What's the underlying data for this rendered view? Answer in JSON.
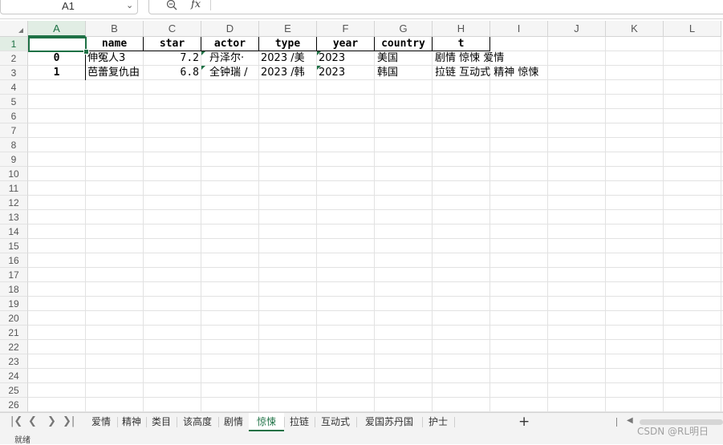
{
  "formula_bar": {
    "name_box": "A1",
    "fx_label": "fx",
    "formula": ""
  },
  "columns": [
    "A",
    "B",
    "C",
    "D",
    "E",
    "F",
    "G",
    "H",
    "I",
    "J",
    "K",
    "L"
  ],
  "rows": [
    "1",
    "2",
    "3",
    "4",
    "5",
    "6",
    "7",
    "8",
    "9",
    "10",
    "11",
    "12",
    "13",
    "14",
    "15",
    "16",
    "17",
    "18",
    "19",
    "20",
    "21",
    "22",
    "23",
    "24",
    "25",
    "26"
  ],
  "active_cell": "A1",
  "table": {
    "headers": [
      "name",
      "star",
      "actor",
      "type",
      "year",
      "country",
      "t"
    ],
    "records": [
      {
        "index": "0",
        "name": "伸冤人3",
        "star": "7.2",
        "actor": "丹泽尔·",
        "type": "2023  /美",
        "year": "2023",
        "country": "美国",
        "t": "剧情  惊悚  爱情"
      },
      {
        "index": "1",
        "name": "芭蕾复仇由",
        "star": "6.8",
        "actor": "全钟瑞 /",
        "type": "2023  /韩",
        "year": "2023",
        "country": "韩国",
        "t": "拉链 互动式  精神  惊悚"
      }
    ]
  },
  "sheet_tabs": [
    "爱情",
    "精神",
    "类目",
    "该高度",
    "剧情",
    "惊悚",
    "拉链",
    "互动式",
    "爱国苏丹国",
    "护士"
  ],
  "active_tab": "惊悚",
  "status_bar": {
    "text": "就绪"
  },
  "watermark": "CSDN @RL明日",
  "colors": {
    "accent": "#1e7145",
    "header_bg": "#f5f5f5",
    "gridline": "#e2e2e2"
  }
}
